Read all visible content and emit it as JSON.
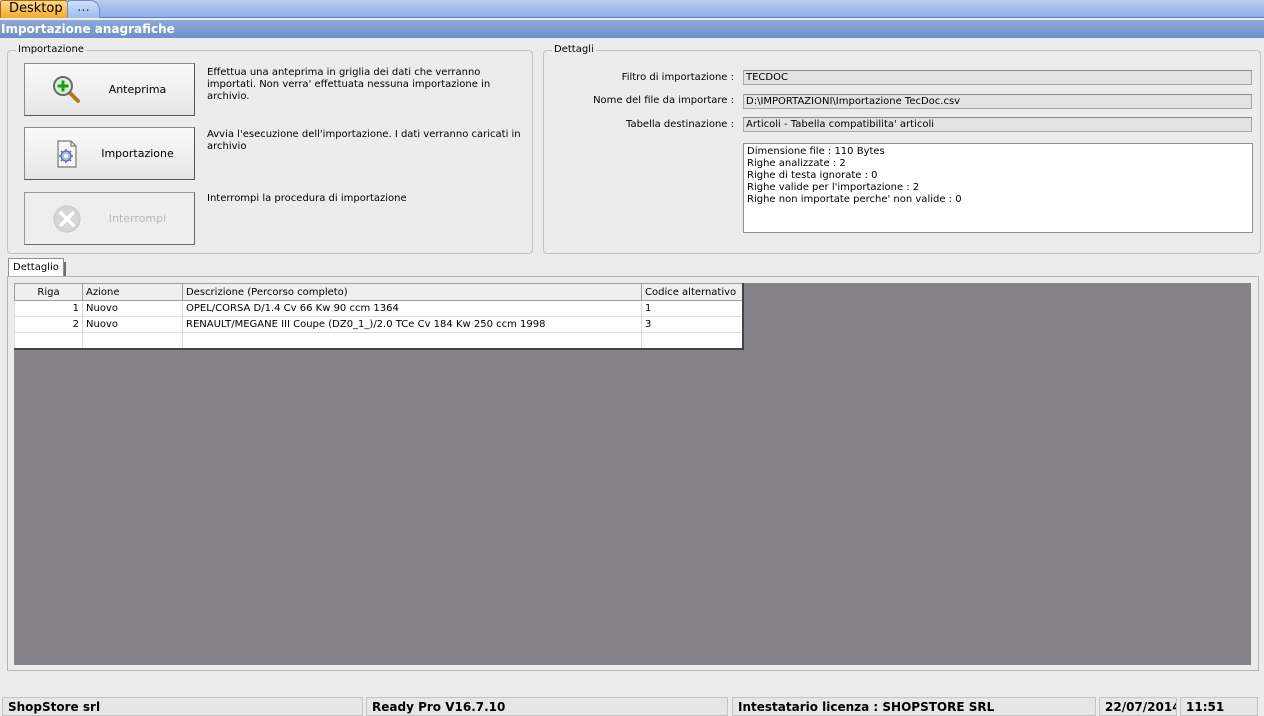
{
  "tabs": {
    "desktop": "Desktop",
    "more": "..."
  },
  "window_title": "Importazione anagrafiche",
  "importazione": {
    "legend": "Importazione",
    "buttons": [
      {
        "label": "Anteprima",
        "icon": "zoom-in-icon",
        "description": "Effettua una anteprima in griglia dei dati che verranno importati. Non verra' effettuata nessuna importazione in archivio."
      },
      {
        "label": "Importazione",
        "icon": "document-gear-icon",
        "description": "Avvia l'esecuzione dell'importazione. I dati verranno caricati in archivio"
      },
      {
        "label": "Interrompi",
        "icon": "cancel-icon",
        "description": "Interrompi la procedura di importazione",
        "disabled": true
      }
    ]
  },
  "dettagli": {
    "legend": "Dettagli",
    "fields": [
      {
        "label": "Filtro di importazione :",
        "value": "TECDOC"
      },
      {
        "label": "Nome del file da importare :",
        "value": "D:\\IMPORTAZIONI\\Importazione TecDoc.csv"
      },
      {
        "label": "Tabella destinazione :",
        "value": "Articoli - Tabella compatibilita' articoli"
      }
    ],
    "info_lines": [
      "Dimensione file : 110 Bytes",
      "Righe analizzate : 2",
      "Righe di testa ignorate : 0",
      "Righe valide per l'importazione : 2",
      "Righe non importate perche' non valide : 0"
    ]
  },
  "detail_tab": "Dettaglio",
  "grid": {
    "columns": [
      "Riga",
      "Azione",
      "Descrizione (Percorso completo)",
      "Codice alternativo"
    ],
    "rows": [
      [
        "1",
        "Nuovo",
        "OPEL/CORSA D/1.4 Cv 66 Kw 90 ccm 1364",
        "1"
      ],
      [
        "2",
        "Nuovo",
        "RENAULT/MEGANE III Coupe (DZ0_1_)/2.0 TCe  Cv 184 Kw 250 ccm 1998",
        "3"
      ],
      [
        "",
        "",
        "",
        ""
      ]
    ]
  },
  "statusbar": {
    "company": "ShopStore srl",
    "version": "Ready Pro V16.7.10",
    "license": "Intestatario licenza : SHOPSTORE SRL",
    "date": "22/07/2014",
    "time": "11:51"
  },
  "colors": {
    "tabstrip": "#9ebde9",
    "title_bar": "#7b99cd",
    "desktop_tab": "#f5a92d",
    "grid_background": "#858387"
  }
}
